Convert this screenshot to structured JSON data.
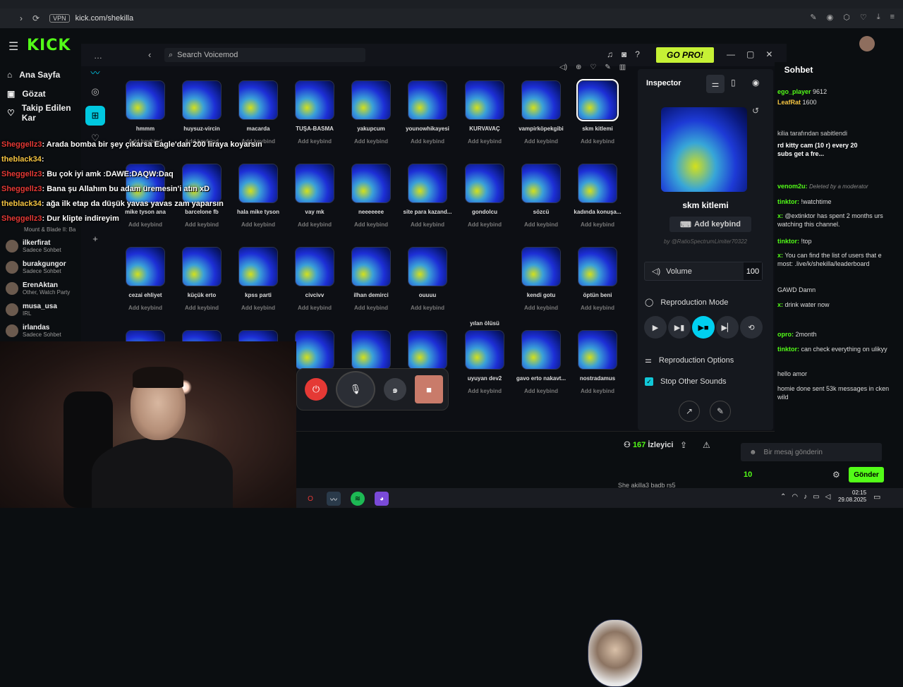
{
  "browser": {
    "url": "kick.com/shekilla",
    "vpn": "VPN"
  },
  "kick": {
    "logo": "KICK",
    "nav": [
      {
        "label": "Ana Sayfa"
      },
      {
        "label": "Gözat"
      },
      {
        "label": "Takip Edilen Kar"
      }
    ],
    "following": [
      {
        "name": "ilkerfirat",
        "sub": "Sadece Sohbet"
      },
      {
        "name": "burakgungor",
        "sub": "Sadece Sohbet"
      },
      {
        "name": "ErenAktan",
        "sub": "Other, Watch Party"
      },
      {
        "name": "musa_usa",
        "sub": "IRL"
      },
      {
        "name": "irlandas",
        "sub": "Sadece Sohbet"
      }
    ],
    "partial_following": {
      "name": "Mount & Blade II: Ba"
    }
  },
  "voicemod": {
    "search_placeholder": "Search Voicemod",
    "go_pro": "GO PRO!",
    "tiles": [
      {
        "name": "hmmm",
        "key": "Add keybind"
      },
      {
        "name": "huysuz-vircin",
        "key": "Add keybind"
      },
      {
        "name": "macarda",
        "key": "Add keybind"
      },
      {
        "name": "TUŞA-BASMA",
        "key": "Add keybind"
      },
      {
        "name": "yakupcum",
        "key": "Add keybind"
      },
      {
        "name": "younowhikayesi",
        "key": "Add keybind"
      },
      {
        "name": "KURVAVAÇ",
        "key": "Add keybind"
      },
      {
        "name": "vampirköpekgibi",
        "key": "Add keybind"
      },
      {
        "name": "skm kitlemi",
        "key": "Add keybind"
      },
      {
        "name": "mike tyson ana",
        "key": "Add keybind"
      },
      {
        "name": "barcelone fb",
        "key": "Add keybind"
      },
      {
        "name": "hala mike tyson",
        "key": "Add keybind"
      },
      {
        "name": "vay mk",
        "key": "Add keybind"
      },
      {
        "name": "neeeeeee",
        "key": "Add keybind"
      },
      {
        "name": "site para kazand...",
        "key": "Add keybind"
      },
      {
        "name": "gondolcu",
        "key": "Add keybind"
      },
      {
        "name": "sözcü",
        "key": "Add keybind"
      },
      {
        "name": "kadında konuşa...",
        "key": "Add keybind"
      },
      {
        "name": "cezai ehliyet",
        "key": "Add keybind"
      },
      {
        "name": "küçük erto",
        "key": "Add keybind"
      },
      {
        "name": "kpss parti",
        "key": "Add keybind"
      },
      {
        "name": "civcivv",
        "key": "Add keybind"
      },
      {
        "name": "ilhan demirci",
        "key": "Add keybind"
      },
      {
        "name": "ouuuu",
        "key": "Add keybind"
      },
      {
        "name": "yılan ölüsü",
        "key": "Add keybind"
      },
      {
        "name": "kendi gotu",
        "key": "Add keybind"
      },
      {
        "name": "öptün beni",
        "key": "Add keybind"
      },
      {
        "name": "",
        "key": ""
      },
      {
        "name": "",
        "key": ""
      },
      {
        "name": "",
        "key": ""
      },
      {
        "name": "",
        "key": ""
      },
      {
        "name": "",
        "key": ""
      },
      {
        "name": "",
        "key": ""
      },
      {
        "name": "uyuyan dev2",
        "key": "Add keybind"
      },
      {
        "name": "gavo erto nakavt...",
        "key": "Add keybind"
      },
      {
        "name": "nostradamus",
        "key": "Add keybind"
      }
    ],
    "inspector": {
      "title": "Inspector",
      "sound_name": "skm kitlemi",
      "add_keybind": "Add keybind",
      "by": "by @RatioSpectrumLimiter70322",
      "volume_label": "Volume",
      "volume_value": "100",
      "repro_mode": "Reproduction Mode",
      "repro_options": "Reproduction Options",
      "stop_other": "Stop Other Sounds"
    }
  },
  "overlay_chat": [
    {
      "user": "Sheggellz3",
      "text": ": Arada bomba bir şey çıkarsa Eagle'dan 200 liraya koyarsın"
    },
    {
      "user": "theblack34",
      "text": ":"
    },
    {
      "user": "Sheggellz3",
      "text": ": Bu çok iyi amk :DAWE:DAQW:Daq"
    },
    {
      "user": "Sheggellz3",
      "text": ": Bana şu Allahım bu adam üremesin'i atın xD"
    },
    {
      "user": "theblack34",
      "text": ": ağa ilk etap da düşük yavas yavas zam yaparsın"
    },
    {
      "user": "Sheggellz3",
      "text": ": Dur klipte indireyim"
    }
  ],
  "chat": {
    "title": "Sohbet",
    "pinned": "kilia tarafından sabitlendi",
    "pinned_text": "rd kitty cam (10 r) every 20 subs get a fre...",
    "messages": [
      {
        "user": "ego_player",
        "text": "9612"
      },
      {
        "user": "LeafRat",
        "text": "1600"
      },
      {
        "user": "venom2u:",
        "text": "Deleted by a moderator"
      },
      {
        "user": "tinktor:",
        "text": "!watchtime"
      },
      {
        "user": "x:",
        "text": "@extinktor has spent 2 months urs watching this channel."
      },
      {
        "user": "tinktor:",
        "text": "!top"
      },
      {
        "user": "x:",
        "text": "You can find the list of users that e most: .live/k/shekilla/leaderboard"
      },
      {
        "user": "",
        "text": "GAWD Damn"
      },
      {
        "user": "x:",
        "text": "drink water now"
      },
      {
        "user": "opro:",
        "text": "2month"
      },
      {
        "user": "tinktor:",
        "text": "can check everything on ulikyy"
      },
      {
        "user": "",
        "text": "hello amor"
      },
      {
        "user": "",
        "text": "homie done sent 53k messages in cken wild"
      }
    ],
    "input_placeholder": "Bir mesaj gönderin",
    "points": "10",
    "send": "Gönder"
  },
  "stream": {
    "viewers": "167",
    "viewers_label": "İzleyici",
    "ticker": "She akilla3   badb rs5"
  },
  "clock": {
    "time": "02:15",
    "date": "29.08.2025"
  }
}
